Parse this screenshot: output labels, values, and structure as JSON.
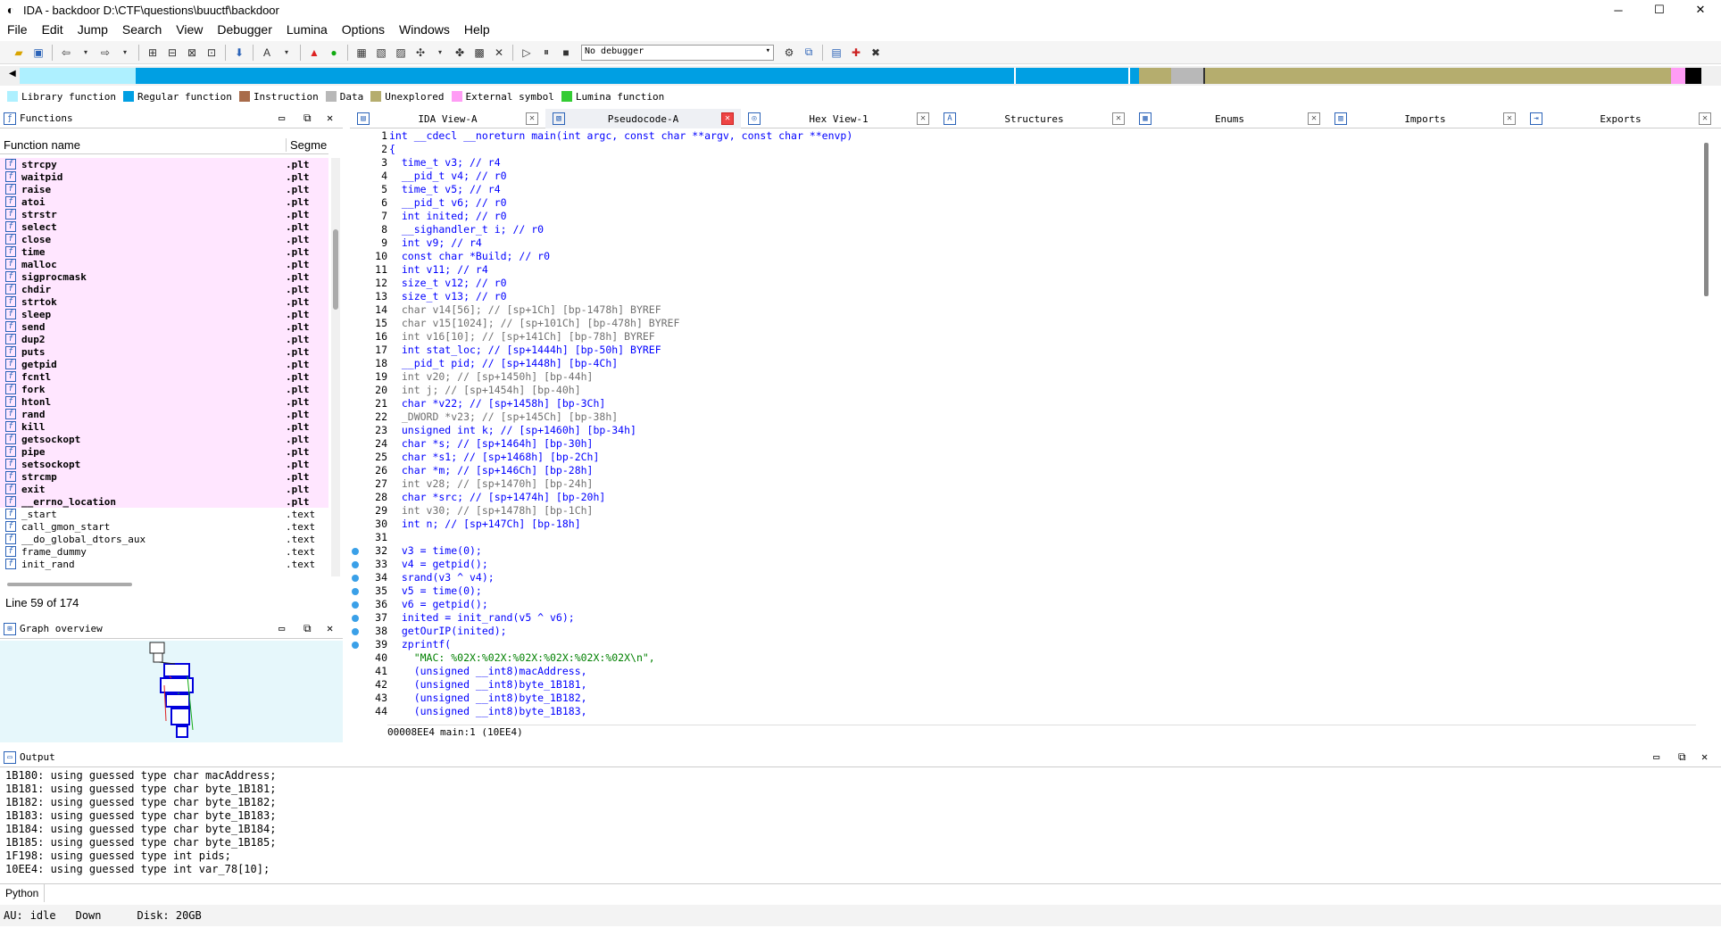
{
  "window": {
    "title": "IDA - backdoor D:\\CTF\\questions\\buuctf\\backdoor",
    "minimize": "─",
    "maximize": "☐",
    "close": "✕"
  },
  "menu": [
    "File",
    "Edit",
    "Jump",
    "Search",
    "View",
    "Debugger",
    "Lumina",
    "Options",
    "Windows",
    "Help"
  ],
  "toolbar": {
    "debugger_select": "No debugger"
  },
  "legend": [
    {
      "label": "Library function",
      "color": "#aef0ff"
    },
    {
      "label": "Regular function",
      "color": "#009fe3"
    },
    {
      "label": "Instruction",
      "color": "#a86b4a"
    },
    {
      "label": "Data",
      "color": "#b8b8b8"
    },
    {
      "label": "Unexplored",
      "color": "#b5ad6e"
    },
    {
      "label": "External symbol",
      "color": "#ff9cf5"
    },
    {
      "label": "Lumina function",
      "color": "#33cc33"
    }
  ],
  "functions_pane": {
    "title": "Functions",
    "col_name": "Function name",
    "col_segment": "Segme",
    "items": [
      {
        "name": "strcpy",
        "seg": ".plt"
      },
      {
        "name": "waitpid",
        "seg": ".plt"
      },
      {
        "name": "raise",
        "seg": ".plt"
      },
      {
        "name": "atoi",
        "seg": ".plt"
      },
      {
        "name": "strstr",
        "seg": ".plt"
      },
      {
        "name": "select",
        "seg": ".plt"
      },
      {
        "name": "close",
        "seg": ".plt"
      },
      {
        "name": "time",
        "seg": ".plt"
      },
      {
        "name": "malloc",
        "seg": ".plt"
      },
      {
        "name": "sigprocmask",
        "seg": ".plt"
      },
      {
        "name": "chdir",
        "seg": ".plt"
      },
      {
        "name": "strtok",
        "seg": ".plt"
      },
      {
        "name": "sleep",
        "seg": ".plt"
      },
      {
        "name": "send",
        "seg": ".plt"
      },
      {
        "name": "dup2",
        "seg": ".plt"
      },
      {
        "name": "puts",
        "seg": ".plt"
      },
      {
        "name": "getpid",
        "seg": ".plt"
      },
      {
        "name": "fcntl",
        "seg": ".plt"
      },
      {
        "name": "fork",
        "seg": ".plt"
      },
      {
        "name": "htonl",
        "seg": ".plt"
      },
      {
        "name": "rand",
        "seg": ".plt"
      },
      {
        "name": "kill",
        "seg": ".plt"
      },
      {
        "name": "getsockopt",
        "seg": ".plt"
      },
      {
        "name": "pipe",
        "seg": ".plt"
      },
      {
        "name": "setsockopt",
        "seg": ".plt"
      },
      {
        "name": "strcmp",
        "seg": ".plt"
      },
      {
        "name": "exit",
        "seg": ".plt"
      },
      {
        "name": "__errno_location",
        "seg": ".plt"
      },
      {
        "name": "_start",
        "seg": ".text"
      },
      {
        "name": "call_gmon_start",
        "seg": ".text"
      },
      {
        "name": "__do_global_dtors_aux",
        "seg": ".text"
      },
      {
        "name": "frame_dummy",
        "seg": ".text"
      },
      {
        "name": "init_rand",
        "seg": ".text"
      }
    ],
    "status": "Line 59 of 174"
  },
  "graph_pane": {
    "title": "Graph overview"
  },
  "tabs": [
    {
      "label": "IDA View-A",
      "icon": "listing-icon"
    },
    {
      "label": "Pseudocode-A",
      "icon": "pseudocode-icon",
      "active": true
    },
    {
      "label": "Hex View-1",
      "icon": "hex-icon"
    },
    {
      "label": "Structures",
      "icon": "structures-icon"
    },
    {
      "label": "Enums",
      "icon": "enums-icon"
    },
    {
      "label": "Imports",
      "icon": "imports-icon"
    },
    {
      "label": "Exports",
      "icon": "exports-icon"
    }
  ],
  "code": [
    {
      "n": "1",
      "t": "int __cdecl __noreturn main(int argc, const char **argv, const char **envp)",
      "cls": "k"
    },
    {
      "n": "2",
      "t": "{",
      "cls": "k"
    },
    {
      "n": "3",
      "t": "  time_t v3; // r4"
    },
    {
      "n": "4",
      "t": "  __pid_t v4; // r0"
    },
    {
      "n": "5",
      "t": "  time_t v5; // r4"
    },
    {
      "n": "6",
      "t": "  __pid_t v6; // r0"
    },
    {
      "n": "7",
      "t": "  int inited; // r0"
    },
    {
      "n": "8",
      "t": "  __sighandler_t i; // r0"
    },
    {
      "n": "9",
      "t": "  int v9; // r4"
    },
    {
      "n": "10",
      "t": "  const char *Build; // r0"
    },
    {
      "n": "11",
      "t": "  int v11; // r4"
    },
    {
      "n": "12",
      "t": "  size_t v12; // r0"
    },
    {
      "n": "13",
      "t": "  size_t v13; // r0"
    },
    {
      "n": "14",
      "t": "  char v14[56]; // [sp+1Ch] [bp-1478h] BYREF",
      "grey": true
    },
    {
      "n": "15",
      "t": "  char v15[1024]; // [sp+101Ch] [bp-478h] BYREF",
      "grey": true
    },
    {
      "n": "16",
      "t": "  int v16[10]; // [sp+141Ch] [bp-78h] BYREF",
      "grey": true
    },
    {
      "n": "17",
      "t": "  int stat_loc; // [sp+1444h] [bp-50h] BYREF"
    },
    {
      "n": "18",
      "t": "  __pid_t pid; // [sp+1448h] [bp-4Ch]"
    },
    {
      "n": "19",
      "t": "  int v20; // [sp+1450h] [bp-44h]",
      "grey": true
    },
    {
      "n": "20",
      "t": "  int j; // [sp+1454h] [bp-40h]",
      "grey": true
    },
    {
      "n": "21",
      "t": "  char *v22; // [sp+1458h] [bp-3Ch]"
    },
    {
      "n": "22",
      "t": "  _DWORD *v23; // [sp+145Ch] [bp-38h]",
      "grey": true
    },
    {
      "n": "23",
      "t": "  unsigned int k; // [sp+1460h] [bp-34h]"
    },
    {
      "n": "24",
      "t": "  char *s; // [sp+1464h] [bp-30h]"
    },
    {
      "n": "25",
      "t": "  char *s1; // [sp+1468h] [bp-2Ch]"
    },
    {
      "n": "26",
      "t": "  char *m; // [sp+146Ch] [bp-28h]"
    },
    {
      "n": "27",
      "t": "  int v28; // [sp+1470h] [bp-24h]",
      "grey": true
    },
    {
      "n": "28",
      "t": "  char *src; // [sp+1474h] [bp-20h]"
    },
    {
      "n": "29",
      "t": "  int v30; // [sp+1478h] [bp-1Ch]",
      "grey": true
    },
    {
      "n": "30",
      "t": "  int n; // [sp+147Ch] [bp-18h]"
    },
    {
      "n": "31",
      "t": ""
    },
    {
      "n": "32",
      "t": "  v3 = time(0);",
      "dot": true
    },
    {
      "n": "33",
      "t": "  v4 = getpid();",
      "dot": true
    },
    {
      "n": "34",
      "t": "  srand(v3 ^ v4);",
      "dot": true
    },
    {
      "n": "35",
      "t": "  v5 = time(0);",
      "dot": true
    },
    {
      "n": "36",
      "t": "  v6 = getpid();",
      "dot": true
    },
    {
      "n": "37",
      "t": "  inited = init_rand(v5 ^ v6);",
      "dot": true
    },
    {
      "n": "38",
      "t": "  getOurIP(inited);",
      "dot": true
    },
    {
      "n": "39",
      "t": "  zprintf(",
      "dot": true
    },
    {
      "n": "40",
      "t": "    \"MAC: %02X:%02X:%02X:%02X:%02X:%02X\\n\",",
      "str": true
    },
    {
      "n": "41",
      "t": "    (unsigned __int8)macAddress,"
    },
    {
      "n": "42",
      "t": "    (unsigned __int8)byte_1B181,"
    },
    {
      "n": "43",
      "t": "    (unsigned __int8)byte_1B182,"
    },
    {
      "n": "44",
      "t": "    (unsigned __int8)byte_1B183,"
    }
  ],
  "code_status": {
    "address": "00008EE4",
    "location": "main:1 (10EE4)"
  },
  "output_pane": {
    "title": "Output",
    "lines": [
      "1B180: using guessed type char macAddress;",
      "1B181: using guessed type char byte_1B181;",
      "1B182: using guessed type char byte_1B182;",
      "1B183: using guessed type char byte_1B183;",
      "1B184: using guessed type char byte_1B184;",
      "1B185: using guessed type char byte_1B185;",
      "1F198: using guessed type int pids;",
      "10EE4: using guessed type int var_78[10];"
    ],
    "lang": "Python"
  },
  "statusbar": {
    "au": "AU:",
    "state": "idle",
    "dir": "Down",
    "disk": "Disk: 20GB"
  }
}
